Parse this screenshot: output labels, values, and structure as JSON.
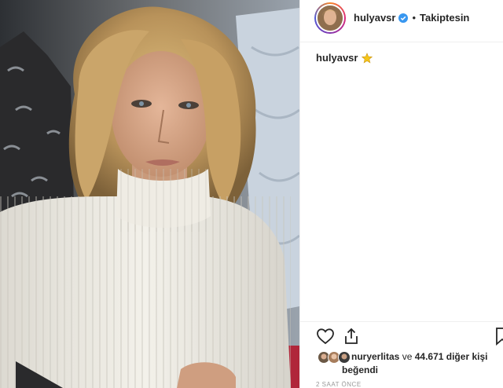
{
  "post": {
    "username": "hulyavsr",
    "verified": true,
    "separator": "•",
    "follow_status": "Takiptesin",
    "caption_user": "hulyavsr",
    "caption_emoji": "star",
    "likes_prefix_user": "nuryerlitas",
    "likes_conjunction": "ve",
    "likes_count": "44.671 diğer kişi",
    "likes_suffix": "beğendi",
    "timestamp": "2 SAAT ÖNCE"
  },
  "icons": {
    "avatar": "profile-avatar",
    "verified": "verified-badge-icon",
    "like": "heart-icon",
    "share": "share-icon",
    "save": "bookmark-icon",
    "caption_emoji": "star-icon"
  },
  "colors": {
    "text": "#262626",
    "verified": "#3897f0",
    "star": "#f5c518",
    "timestamp": "#999999",
    "divider": "#efefef"
  }
}
